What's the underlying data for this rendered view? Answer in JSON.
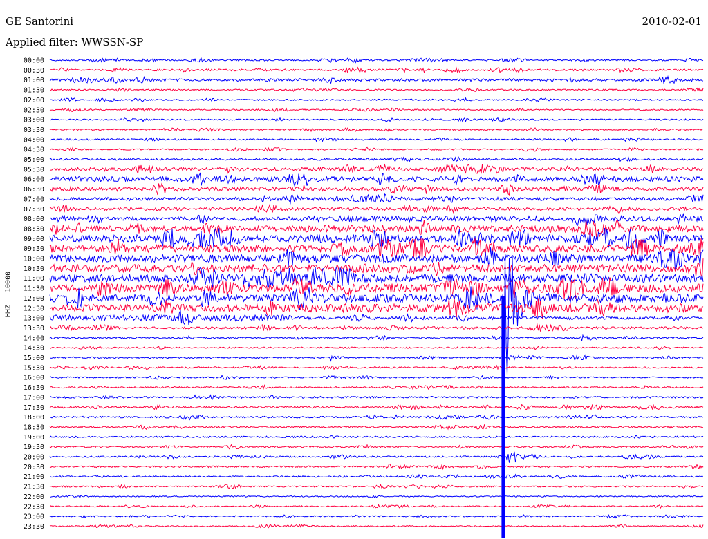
{
  "header": {
    "station": "GE Santorini",
    "date": "2010-02-01",
    "filter_label": "Applied filter:",
    "filter_value": "WWSSN-SP",
    "channel": "HHZ - 10000"
  },
  "colors": {
    "trace_a": "#0000ff",
    "trace_b": "#ff0040",
    "background": "#ffffff",
    "text": "#000000"
  },
  "chart_data": {
    "type": "line",
    "title": "GE Santorini",
    "subtitle": "Applied filter: WWSSN-SP",
    "date": "2010-02-01",
    "ylabel": "HHZ - 10000",
    "row_interval_minutes": 30,
    "row_labels": [
      "00:00",
      "00:30",
      "01:00",
      "01:30",
      "02:00",
      "02:30",
      "03:00",
      "03:30",
      "04:00",
      "04:30",
      "05:00",
      "05:30",
      "06:00",
      "06:30",
      "07:00",
      "07:30",
      "08:00",
      "08:30",
      "09:00",
      "09:30",
      "10:00",
      "10:30",
      "11:00",
      "11:30",
      "12:00",
      "12:30",
      "13:00",
      "13:30",
      "14:00",
      "14:30",
      "15:00",
      "15:30",
      "16:00",
      "16:30",
      "17:00",
      "17:30",
      "18:00",
      "18:30",
      "19:00",
      "19:30",
      "20:00",
      "20:30",
      "21:00",
      "21:30",
      "22:00",
      "22:30",
      "23:00",
      "23:30"
    ],
    "row_colors": [
      "blue",
      "red",
      "blue",
      "red",
      "blue",
      "red",
      "blue",
      "red",
      "blue",
      "red",
      "blue",
      "red",
      "blue",
      "red",
      "blue",
      "red",
      "blue",
      "red",
      "blue",
      "red",
      "blue",
      "red",
      "blue",
      "red",
      "blue",
      "red",
      "blue",
      "red",
      "blue",
      "red",
      "blue",
      "red",
      "blue",
      "red",
      "blue",
      "red",
      "blue",
      "red",
      "blue",
      "red",
      "blue",
      "red",
      "blue",
      "red",
      "blue",
      "red",
      "blue",
      "red"
    ],
    "noise_level": [
      1.3,
      1.6,
      2.2,
      1.3,
      1.2,
      1.1,
      1.2,
      1.2,
      1.3,
      1.2,
      1.6,
      3.0,
      4.0,
      3.5,
      2.8,
      2.6,
      3.0,
      4.6,
      6.0,
      6.0,
      6.2,
      6.4,
      6.6,
      6.2,
      6.0,
      6.0,
      5.2,
      2.0,
      1.3,
      1.2,
      1.3,
      1.2,
      1.2,
      1.3,
      1.5,
      1.6,
      1.5,
      1.4,
      1.4,
      1.3,
      1.3,
      1.4,
      1.3,
      1.2,
      1.0,
      1.0,
      1.0,
      1.0
    ],
    "noise_level_late": [
      1.3,
      1.6,
      2.2,
      1.3,
      1.2,
      1.1,
      1.2,
      1.2,
      1.3,
      1.2,
      1.6,
      3.0,
      4.0,
      3.5,
      2.8,
      2.6,
      4.5,
      6.0,
      6.5,
      6.5,
      6.8,
      7.0,
      7.2,
      7.0,
      7.4,
      7.0,
      2.5,
      2.0,
      1.3,
      1.2,
      1.3,
      1.2,
      1.2,
      1.3,
      1.5,
      1.6,
      1.5,
      1.4,
      1.4,
      1.3,
      1.3,
      1.4,
      1.3,
      1.2,
      1.0,
      1.0,
      1.0,
      1.0
    ],
    "level_change_fraction": 0.37,
    "events": [
      {
        "row": "12:00",
        "minute": 20.8,
        "type": "large earthquake",
        "peak_amplitude_rows": 11
      },
      {
        "row": "20:00",
        "minute": 21.0,
        "type": "aftershock",
        "peak_amplitude_rows": 1.2
      },
      {
        "row": "17:30",
        "minute": 21.5,
        "type": "local event",
        "peak_amplitude_rows": 0.6
      },
      {
        "row": "20:30",
        "minute": 15.5,
        "type": "local event",
        "peak_amplitude_rows": 0.3
      },
      {
        "row": "14:00",
        "minute": 24.4,
        "type": "local event",
        "peak_amplitude_rows": 0.3
      },
      {
        "row": "15:00",
        "minute": 12.9,
        "type": "local event",
        "peak_amplitude_rows": 0.3
      },
      {
        "row": "16:00",
        "minute": 7.9,
        "type": "local event",
        "peak_amplitude_rows": 0.3
      }
    ]
  }
}
